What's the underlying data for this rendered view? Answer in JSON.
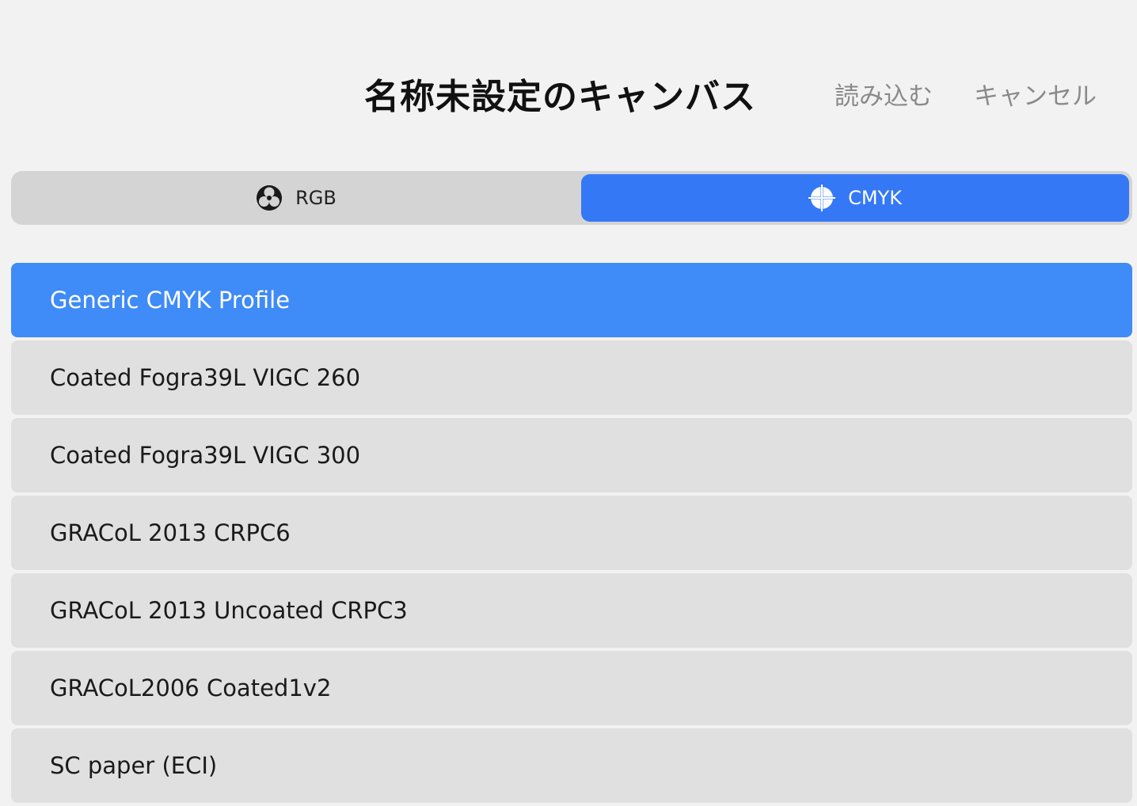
{
  "header": {
    "title": "名称未設定のキャンバス",
    "import_label": "読み込む",
    "cancel_label": "キャンセル"
  },
  "color_mode": {
    "options": [
      {
        "label": "RGB",
        "icon": "rgb-circles-icon",
        "selected": false
      },
      {
        "label": "CMYK",
        "icon": "registration-mark-icon",
        "selected": true
      }
    ]
  },
  "profiles": {
    "items": [
      {
        "label": "Generic CMYK Profile",
        "selected": true
      },
      {
        "label": "Coated Fogra39L VIGC 260",
        "selected": false
      },
      {
        "label": "Coated Fogra39L VIGC 300",
        "selected": false
      },
      {
        "label": "GRACoL 2013 CRPC6",
        "selected": false
      },
      {
        "label": "GRACoL 2013 Uncoated CRPC3",
        "selected": false
      },
      {
        "label": "GRACoL2006 Coated1v2",
        "selected": false
      },
      {
        "label": "SC paper (ECI)",
        "selected": false
      }
    ]
  },
  "colors": {
    "accent": "#3478f6",
    "selected_row": "#3f8bf7",
    "row_background": "#e0e0e0",
    "page_background": "#f2f2f2"
  }
}
